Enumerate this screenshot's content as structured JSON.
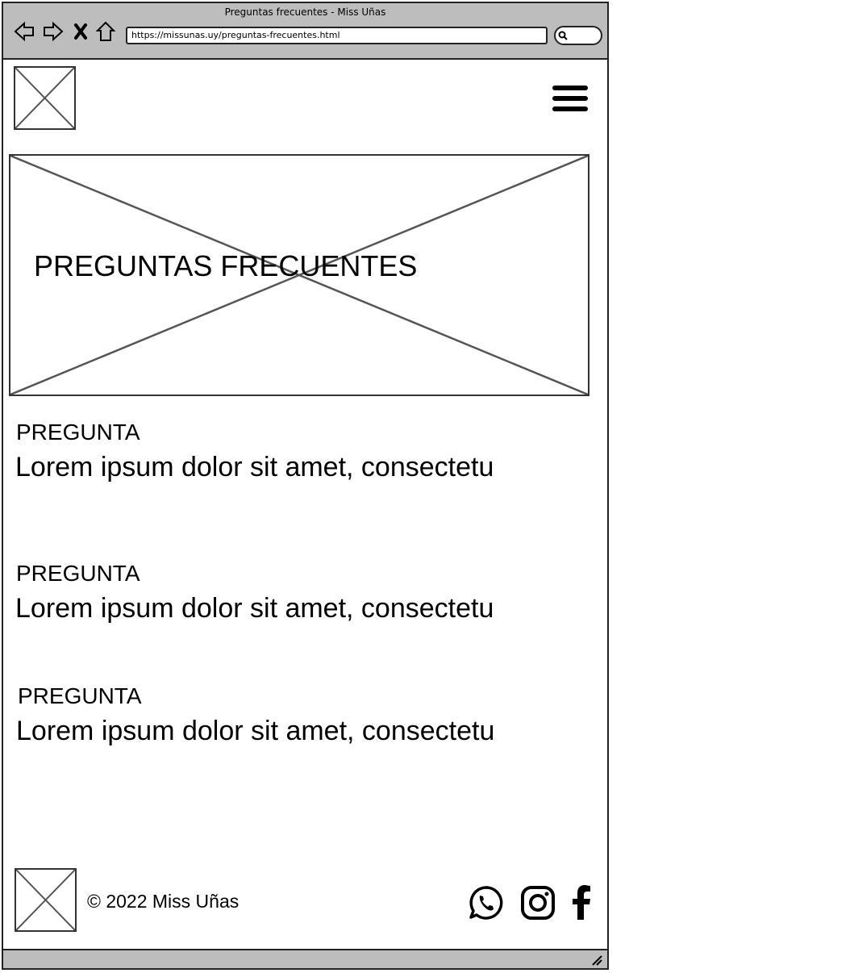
{
  "browser": {
    "window_title": "Preguntas frecuentes - Miss Uñas",
    "url": "https://missunas.uy/preguntas-frecuentes.html"
  },
  "hero": {
    "title": "PREGUNTAS FRECUENTES"
  },
  "faq": [
    {
      "label": "PREGUNTA",
      "text": "Lorem ipsum dolor sit amet, consectetu"
    },
    {
      "label": "PREGUNTA",
      "text": "Lorem ipsum dolor sit amet, consectetu"
    },
    {
      "label": "PREGUNTA",
      "text": "Lorem ipsum dolor sit amet, consectetu"
    }
  ],
  "footer": {
    "copyright": "© 2022 Miss Uñas",
    "social_icons": [
      "whatsapp-icon",
      "instagram-icon",
      "facebook-icon"
    ]
  },
  "icons": {
    "nav": [
      "back-arrow-icon",
      "forward-arrow-icon",
      "close-icon",
      "home-icon"
    ],
    "menu": "hamburger-menu-icon",
    "search": "search-icon"
  }
}
